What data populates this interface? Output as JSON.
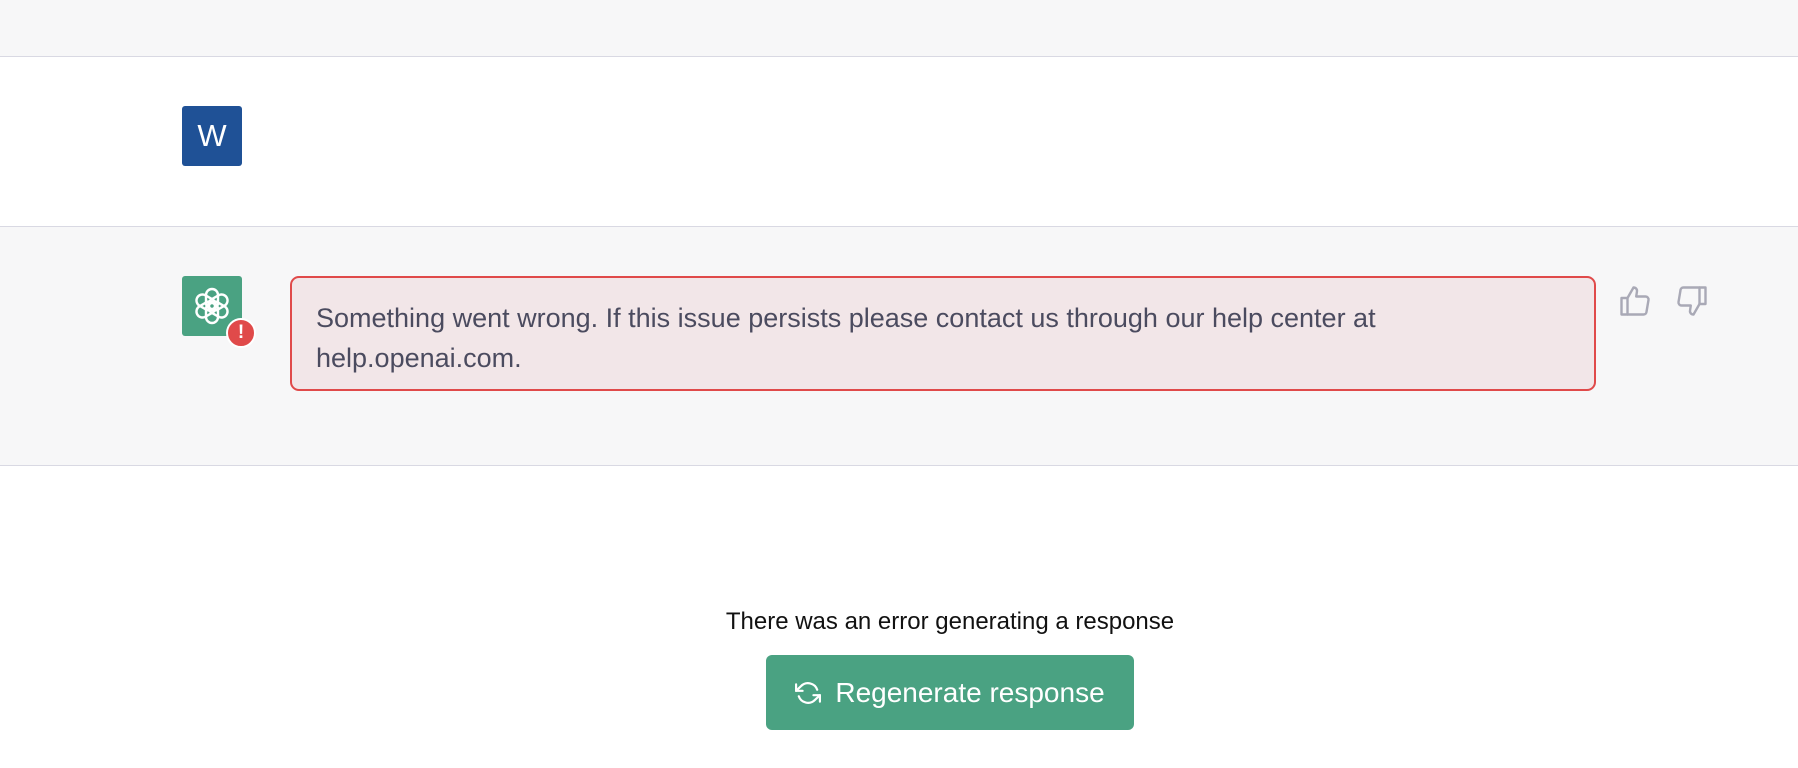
{
  "user_message": {
    "avatar_letter": "W",
    "text": "",
    "avatar_color": "#1f5196"
  },
  "assistant_message": {
    "error_text": "Something went wrong. If this issue persists please contact us through our help center at help.openai.com.",
    "error_badge": "!",
    "avatar_color": "#4aa282",
    "error_color": "#e04a4a"
  },
  "feedback": {
    "thumbs_up_icon": "thumbs-up-icon",
    "thumbs_down_icon": "thumbs-down-icon"
  },
  "footer": {
    "error_note": "There was an error generating a response",
    "regenerate_label": "Regenerate response",
    "regenerate_icon": "refresh-icon",
    "button_color": "#4aa282"
  }
}
